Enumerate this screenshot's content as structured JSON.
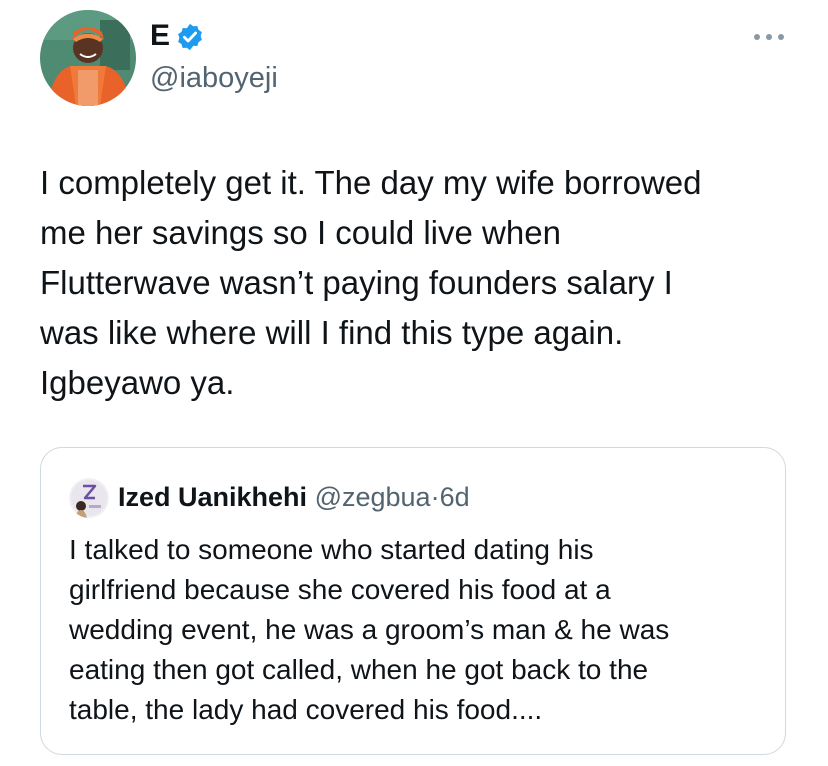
{
  "tweet": {
    "author_name": "E",
    "author_handle": "@iaboyeji",
    "verified_icon": "verified-badge-icon",
    "more_icon": "more-options-icon",
    "text_lines": [
      "I completely get it. The day my wife borrowed",
      "me her savings so I could live when",
      "Flutterwave wasn’t paying founders salary I",
      "was like where will I find this type again.",
      "Igbeyawo ya."
    ]
  },
  "quote": {
    "author_name": "Ized Uanikhehi",
    "author_handle": "@zegbua",
    "separator": "·",
    "time": "6d",
    "text_lines": [
      "I talked to someone who started dating his",
      "girlfriend because she covered his food at a",
      "wedding event, he was a groom’s man & he was",
      "eating then got called, when he got back to the",
      "table, the lady had covered his food...."
    ]
  },
  "colors": {
    "text_primary": "#0f1419",
    "text_secondary": "#536471",
    "verified_blue": "#1d9bf0",
    "card_border": "#cfd9de"
  }
}
